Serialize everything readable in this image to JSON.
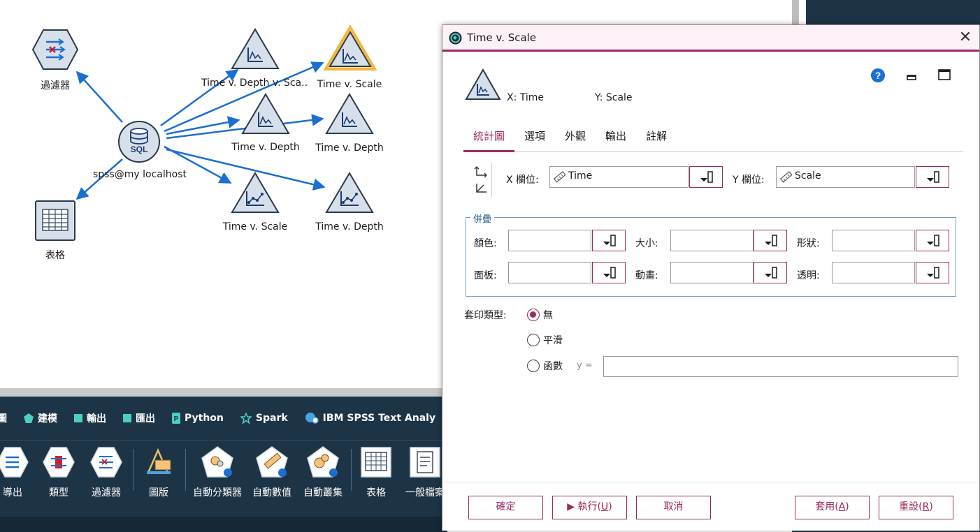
{
  "canvas": {
    "nodes": {
      "filter": "過濾器",
      "table": "表格",
      "source": "spss@my localhost",
      "source_badge": "SQL",
      "plot_time_depth_scale": "Time v. Depth v. Sca..",
      "plot_time_scale_selected": "Time v. Scale",
      "plot_time_depth_1": "Time v. Depth",
      "plot_time_depth_2": "Time v. Depth",
      "plot_time_scale_2": "Time v. Scale",
      "plot_time_depth_3": "Time v. Depth"
    }
  },
  "palette": {
    "tabs": [
      {
        "label": "圖",
        "icon": "square-icon",
        "color": "#4ad0c0"
      },
      {
        "label": "建模",
        "icon": "pentagon-icon",
        "color": "#4ad0c0"
      },
      {
        "label": "輸出",
        "icon": "square-icon",
        "color": "#4ad0c0"
      },
      {
        "label": "匯出",
        "icon": "square-icon",
        "color": "#4ad0c0"
      },
      {
        "label": "Python",
        "icon": "python-icon",
        "color": "#4ad0c0"
      },
      {
        "label": "Spark",
        "icon": "star-icon",
        "color": "#4ad0c0"
      },
      {
        "label": "IBM SPSS Text Analy",
        "icon": "text-analytics-icon",
        "color": "#4aa3e0"
      }
    ],
    "nodes": [
      "導出",
      "類型",
      "過濾器",
      "圖版",
      "自動分類器",
      "自動數值",
      "自動叢集",
      "表格",
      "一般檔案"
    ]
  },
  "dialog": {
    "title": "Time v. Scale",
    "x_axis": "X: Time",
    "y_axis": "Y: Scale",
    "tabs": [
      "統計圖",
      "選項",
      "外觀",
      "輸出",
      "註解"
    ],
    "active_tab": "統計圖",
    "x_field_label": "X 欄位:",
    "x_field_value": "Time",
    "y_field_label": "Y 欄位:",
    "y_field_value": "Scale",
    "overlay_legend": "併疊",
    "overlay_fields": {
      "color": "顏色:",
      "size": "大小:",
      "shape": "形狀:",
      "panel": "面板:",
      "animation": "動畫:",
      "transparency": "透明:"
    },
    "overlay_type_label": "套印類型:",
    "overlay_options": {
      "none": "無",
      "smooth": "平滑",
      "function": "函數"
    },
    "overlay_selected": "none",
    "function_prefix": "y =",
    "function_value": "",
    "buttons": {
      "ok": "確定",
      "run": "執行(",
      "run_key": "U",
      "cancel": "取消",
      "apply": "套用(",
      "apply_key": "A",
      "reset": "重設(",
      "reset_key": "R"
    },
    "accent_color": "#9b2a62"
  }
}
